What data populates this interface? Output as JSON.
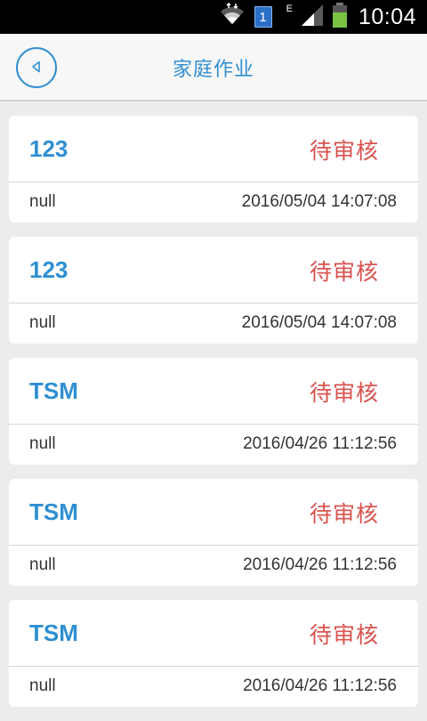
{
  "status_bar": {
    "sim_slot": "1",
    "network_type": "E",
    "time": "10:04",
    "battery_color": "#7ac143"
  },
  "header": {
    "title": "家庭作业",
    "back_icon": "chevron-left-circle-icon",
    "accent_color": "#2f8fd2"
  },
  "items": [
    {
      "title": "123",
      "status": "待审核",
      "desc": "null",
      "time": "2016/05/04 14:07:08"
    },
    {
      "title": "123",
      "status": "待审核",
      "desc": "null",
      "time": "2016/05/04 14:07:08"
    },
    {
      "title": "TSM",
      "status": "待审核",
      "desc": "null",
      "time": "2016/04/26 11:12:56"
    },
    {
      "title": "TSM",
      "status": "待审核",
      "desc": "null",
      "time": "2016/04/26 11:12:56"
    },
    {
      "title": "TSM",
      "status": "待审核",
      "desc": "null",
      "time": "2016/04/26 11:12:56"
    }
  ],
  "status_color": "#d9534f"
}
